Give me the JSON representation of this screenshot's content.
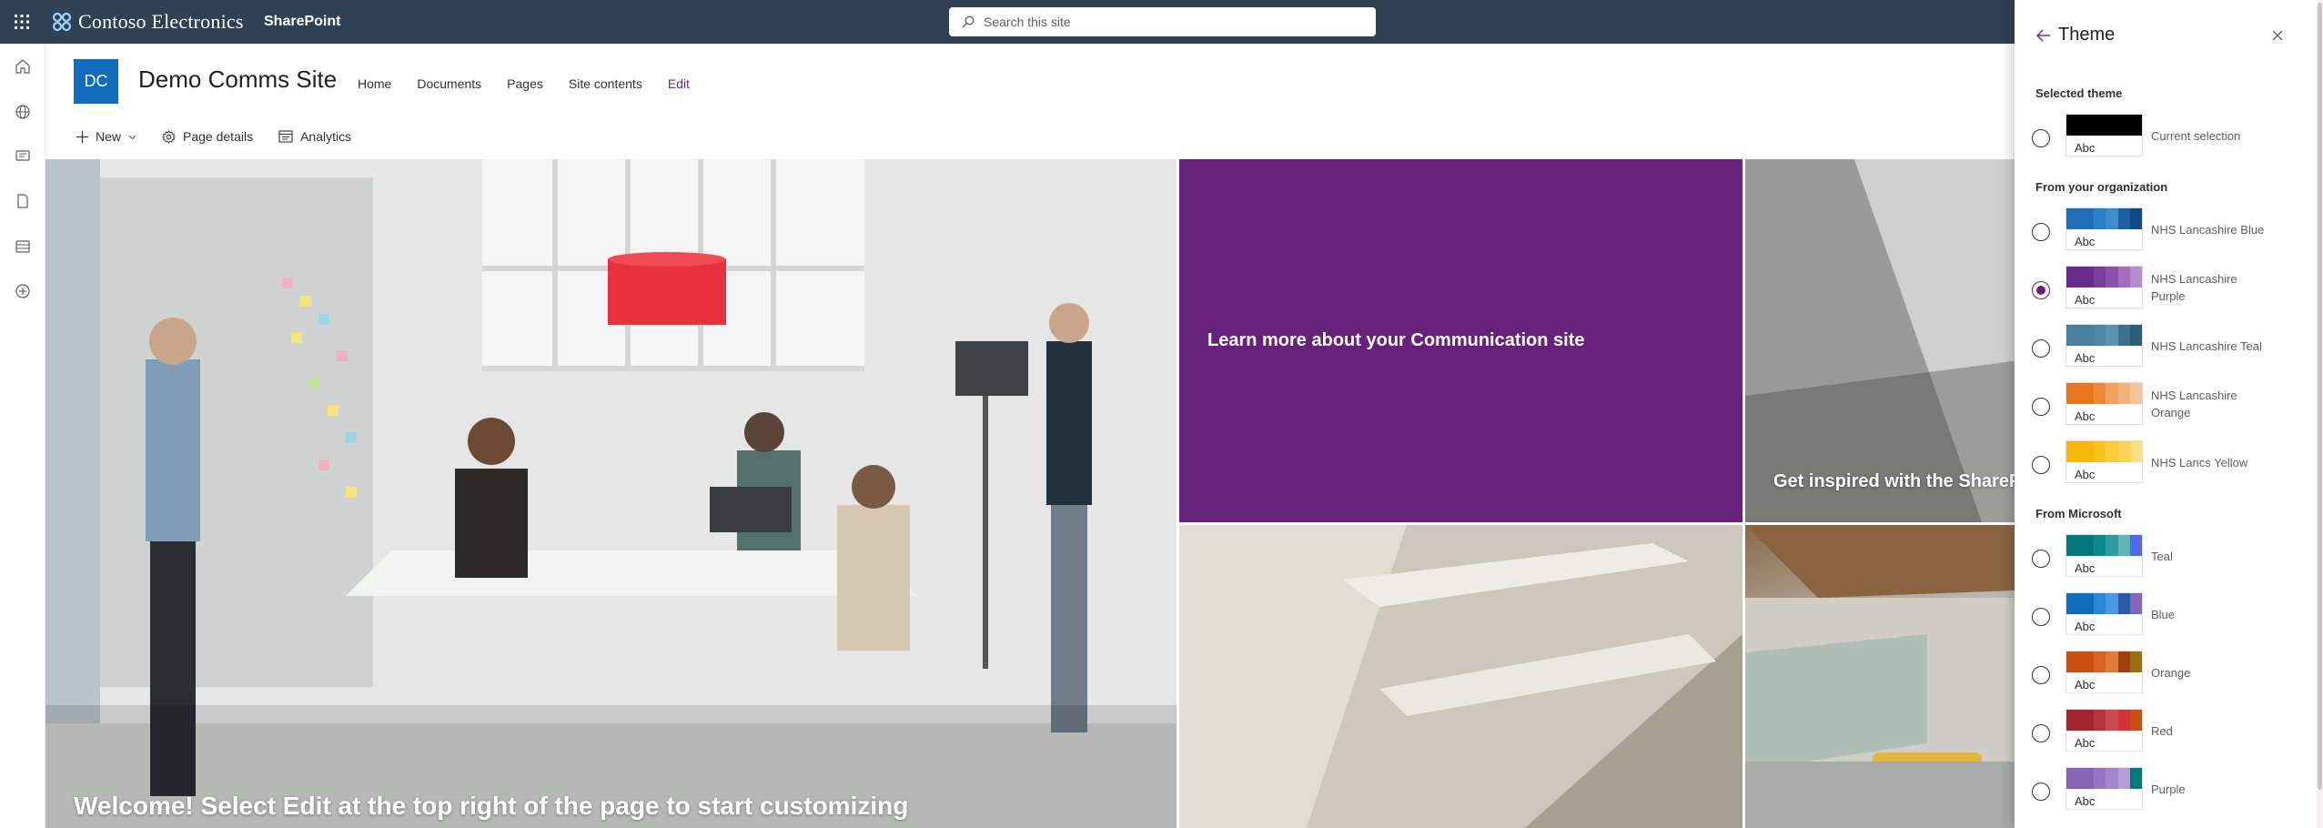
{
  "suitebar": {
    "brand": "Contoso Electronics",
    "app": "SharePoint",
    "search_placeholder": "Search this site"
  },
  "leftrail": {
    "items": [
      "home-icon",
      "globe-icon",
      "news-icon",
      "files-icon",
      "lists-icon",
      "create-icon"
    ]
  },
  "site": {
    "logo_initials": "DC",
    "title": "Demo Comms Site",
    "nav": [
      "Home",
      "Documents",
      "Pages",
      "Site contents"
    ],
    "edit_label": "Edit"
  },
  "commandbar": {
    "new_label": "New",
    "page_details_label": "Page details",
    "analytics_label": "Analytics"
  },
  "hero": {
    "main_text": "Welcome! Select Edit at the top right of the page to start customizing",
    "purple_text": "Learn more about your Communication site",
    "right_top_text": "Get inspired with the SharePo"
  },
  "panel": {
    "title": "Theme",
    "selected_label": "Selected theme",
    "org_label": "From your organization",
    "ms_label": "From Microsoft",
    "swatch_text": "Abc",
    "current": {
      "name": "Current selection",
      "colors": [
        "#000000"
      ]
    },
    "org_themes": [
      {
        "name": "NHS Lancashire Blue",
        "colors": [
          "#1f6fb8",
          "#2b7fc4",
          "#3d8ccb",
          "#1a5f9f",
          "#0f4a86"
        ],
        "selected": false
      },
      {
        "name": "NHS Lancashire Purple",
        "colors": [
          "#6b2a8c",
          "#7a3b99",
          "#8c51ab",
          "#a26cbf",
          "#b68acd"
        ],
        "selected": true
      },
      {
        "name": "NHS Lancashire Teal",
        "colors": [
          "#4a7f9e",
          "#4d86a6",
          "#5a93b0",
          "#3e6f8c",
          "#2f5d78"
        ],
        "selected": false
      },
      {
        "name": "NHS Lancashire Orange",
        "colors": [
          "#e8761e",
          "#ec8836",
          "#f0a060",
          "#f3b27c",
          "#f6c49a"
        ],
        "selected": false
      },
      {
        "name": "NHS Lancs Yellow",
        "colors": [
          "#f7b80a",
          "#f9c21f",
          "#fbcc3a",
          "#fcd455",
          "#fde07a"
        ],
        "selected": false
      }
    ],
    "ms_themes": [
      {
        "name": "Teal",
        "colors": [
          "#03787c",
          "#0b8a8e",
          "#2d9ca0",
          "#5fb5b8",
          "#4f6bed"
        ]
      },
      {
        "name": "Blue",
        "colors": [
          "#0f6cbd",
          "#2886de",
          "#4a98e3",
          "#2b5aa8",
          "#8764b8"
        ]
      },
      {
        "name": "Orange",
        "colors": [
          "#ca5010",
          "#d86320",
          "#e07a3a",
          "#a0400c",
          "#986f0b"
        ]
      },
      {
        "name": "Red",
        "colors": [
          "#a4262c",
          "#b8343a",
          "#c84c51",
          "#d13438",
          "#ca5010"
        ]
      },
      {
        "name": "Purple",
        "colors": [
          "#8764b8",
          "#9574c4",
          "#a586ce",
          "#b79bd8",
          "#03787c"
        ]
      }
    ]
  }
}
